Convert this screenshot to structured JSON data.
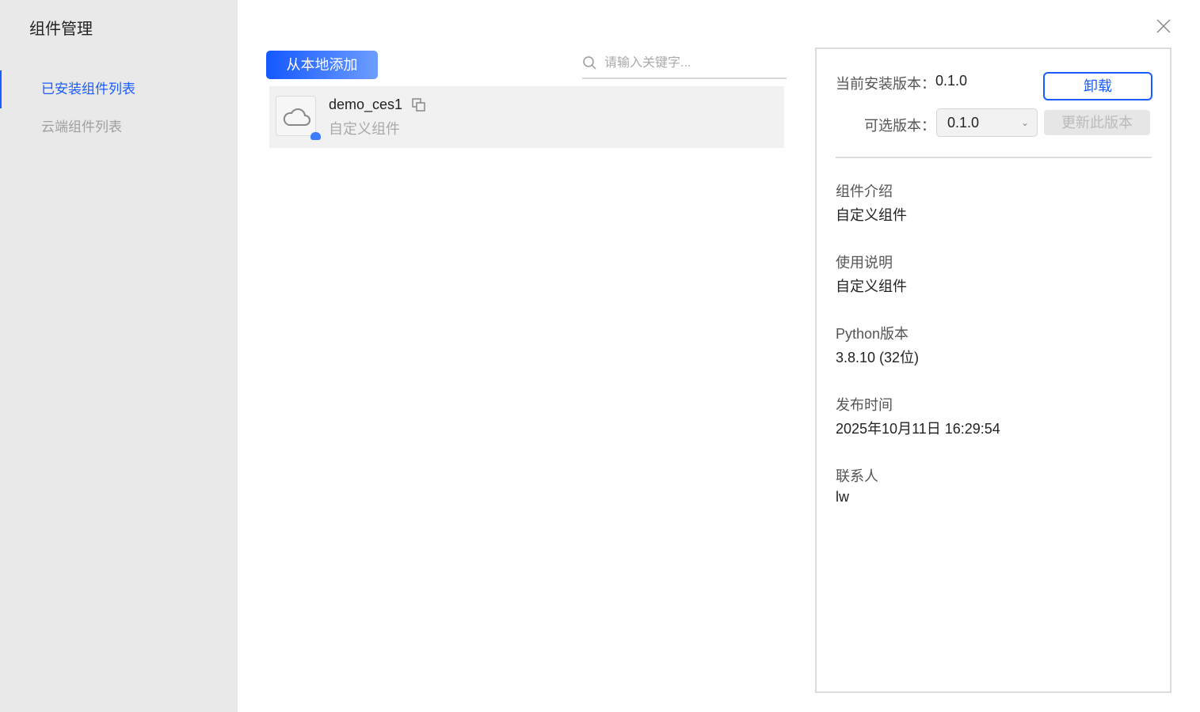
{
  "title": "组件管理",
  "sidebar": {
    "items": [
      {
        "label": "已安装组件列表"
      },
      {
        "label": "云端组件列表"
      }
    ]
  },
  "toolbar": {
    "add_label": "从本地添加",
    "search_placeholder": "请输入关键字..."
  },
  "list": [
    {
      "name": "demo_ces1",
      "desc": "自定义组件"
    }
  ],
  "detail": {
    "current_label": "当前安装版本：",
    "current_value": "0.1.0",
    "uninstall_label": "卸载",
    "optional_label": "可选版本：",
    "optional_value": "0.1.0",
    "update_label": "更新此版本",
    "fields": [
      {
        "label": "组件介绍",
        "value": "自定义组件"
      },
      {
        "label": "使用说明",
        "value": "自定义组件"
      },
      {
        "label": "Python版本",
        "value": "3.8.10 (32位)"
      },
      {
        "label": "发布时间",
        "value": "2025年10月11日 16:29:54"
      },
      {
        "label": "联系人",
        "value": "lw"
      }
    ]
  },
  "colors": {
    "accent": "#1a5cff",
    "sidebar": "#e9e9e9"
  }
}
